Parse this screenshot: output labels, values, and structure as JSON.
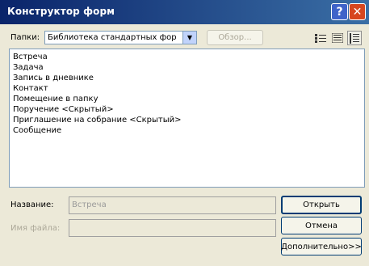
{
  "window": {
    "title": "Конструктор форм",
    "help_glyph": "?",
    "close_glyph": "✕"
  },
  "folder": {
    "label": "Папки:",
    "selected": "Библиотека стандартных форм",
    "browse_label": "Обзор..."
  },
  "view_buttons": [
    "large-icons",
    "small-icons",
    "details"
  ],
  "forms": [
    "Встреча",
    "Задача",
    "Запись в дневнике",
    "Контакт",
    "Помещение в папку",
    "Поручение <Скрытый>",
    "Приглашение на собрание <Скрытый>",
    "Сообщение"
  ],
  "details": {
    "name_label": "Название:",
    "name_value": "Встреча",
    "filename_label": "Имя файла:",
    "filename_value": ""
  },
  "actions": {
    "open": "Открыть",
    "cancel": "Отмена",
    "advanced": "Дополнительно>>"
  },
  "colors": {
    "title_bar": "#0a246a",
    "dialog_bg": "#ece9d8",
    "close_button": "#d7471f"
  }
}
